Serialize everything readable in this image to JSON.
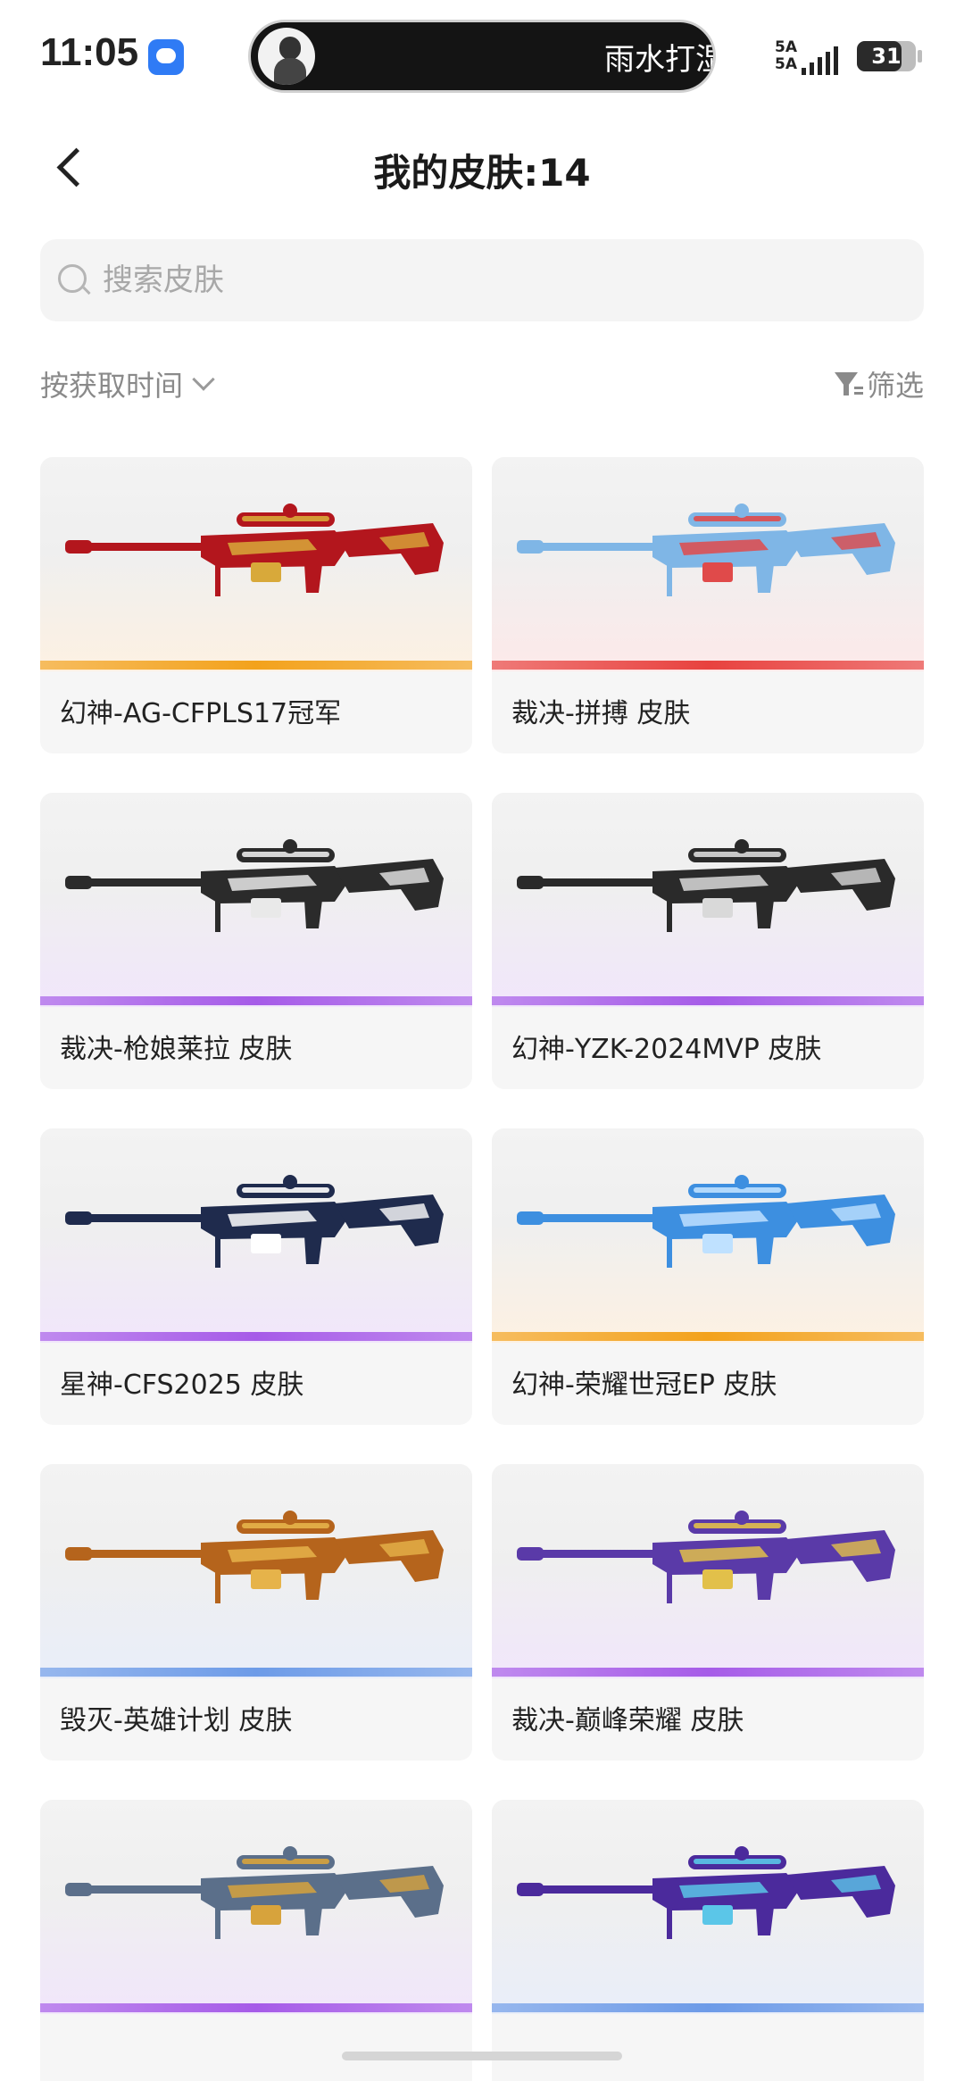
{
  "status_bar": {
    "time": "11:05",
    "island_text": "雨水打湿",
    "signal_line1": "5A",
    "signal_line2": "5A",
    "battery": "31"
  },
  "header": {
    "title": "我的皮肤:14"
  },
  "search": {
    "placeholder": "搜索皮肤",
    "value": ""
  },
  "toolbar": {
    "sort_label": "按获取时间",
    "filter_label": "筛选"
  },
  "skins": [
    {
      "name": "幻神-AG-CFPLS17冠军",
      "rarity_color": "#f3a21c",
      "tint": "#fdf1e2",
      "gun_main": "#b3161d",
      "gun_accent": "#d8a93a"
    },
    {
      "name": "裁决-拼搏 皮肤",
      "rarity_color": "#e8423f",
      "tint": "#fde9e9",
      "gun_main": "#7fb6e6",
      "gun_accent": "#e04a4a"
    },
    {
      "name": "裁决-枪娘莱拉 皮肤",
      "rarity_color": "#a65be8",
      "tint": "#f1e6fb",
      "gun_main": "#2b2b2b",
      "gun_accent": "#e9e9e9"
    },
    {
      "name": "幻神-YZK-2024MVP 皮肤",
      "rarity_color": "#a65be8",
      "tint": "#f1e6fb",
      "gun_main": "#2a2a2a",
      "gun_accent": "#d9d9d9"
    },
    {
      "name": "星神-CFS2025 皮肤",
      "rarity_color": "#a65be8",
      "tint": "#f1e6fb",
      "gun_main": "#1f2b4d",
      "gun_accent": "#ffffff"
    },
    {
      "name": "幻神-荣耀世冠EP 皮肤",
      "rarity_color": "#f3a21c",
      "tint": "#fdf1e2",
      "gun_main": "#3d8fe0",
      "gun_accent": "#bfe1ff"
    },
    {
      "name": "毁灭-英雄计划 皮肤",
      "rarity_color": "#6d9be8",
      "tint": "#e9eef9",
      "gun_main": "#b5641c",
      "gun_accent": "#e6b34a"
    },
    {
      "name": "裁决-巅峰荣耀 皮肤",
      "rarity_color": "#a65be8",
      "tint": "#f1e6fb",
      "gun_main": "#5a3aa8",
      "gun_accent": "#e2c04a"
    },
    {
      "name": "",
      "rarity_color": "#a65be8",
      "tint": "#f1e6fb",
      "gun_main": "#5b6f8a",
      "gun_accent": "#d7a33c"
    },
    {
      "name": "",
      "rarity_color": "#6d9be8",
      "tint": "#e9eef9",
      "gun_main": "#4b2a9c",
      "gun_accent": "#5bc6e8"
    }
  ]
}
